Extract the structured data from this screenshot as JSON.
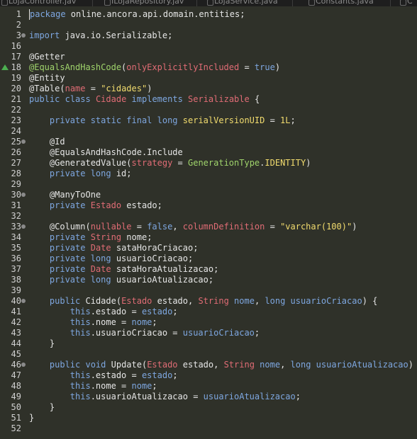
{
  "tabs": [
    {
      "label": "LojaController.jav"
    },
    {
      "label": "ILojaRepository.jav"
    },
    {
      "label": "LojaService.java"
    },
    {
      "label": "Constants.java"
    },
    {
      "label": "C"
    }
  ],
  "lines": [
    {
      "n": "1",
      "code": [
        {
          "c": "kw",
          "t": "package"
        },
        {
          "c": "fld",
          "t": " online.ancora.api.domain.entities;"
        }
      ]
    },
    {
      "n": "2",
      "code": []
    },
    {
      "n": "3",
      "fold": true,
      "code": [
        {
          "c": "kw",
          "t": "import"
        },
        {
          "c": "fld",
          "t": " java.io.Serializable;"
        }
      ]
    },
    {
      "n": "16",
      "code": []
    },
    {
      "n": "17",
      "code": [
        {
          "c": "an",
          "t": "@Getter"
        }
      ]
    },
    {
      "n": "18",
      "marker": true,
      "code": [
        {
          "c": "an2",
          "t": "@EqualsAndHashCode"
        },
        {
          "c": "fld",
          "t": "("
        },
        {
          "c": "pr",
          "t": "onlyExplicitlyIncluded"
        },
        {
          "c": "fld",
          "t": " = "
        },
        {
          "c": "kw",
          "t": "true"
        },
        {
          "c": "fld",
          "t": ")"
        }
      ]
    },
    {
      "n": "19",
      "code": [
        {
          "c": "an",
          "t": "@Entity"
        }
      ]
    },
    {
      "n": "20",
      "code": [
        {
          "c": "an",
          "t": "@Table"
        },
        {
          "c": "fld",
          "t": "("
        },
        {
          "c": "pr",
          "t": "name"
        },
        {
          "c": "fld",
          "t": " = "
        },
        {
          "c": "st",
          "t": "\"cidades\""
        },
        {
          "c": "fld",
          "t": ")"
        }
      ]
    },
    {
      "n": "21",
      "code": [
        {
          "c": "kw",
          "t": "public"
        },
        {
          "c": "fld",
          "t": " "
        },
        {
          "c": "kw",
          "t": "class"
        },
        {
          "c": "fld",
          "t": " "
        },
        {
          "c": "ty",
          "t": "Cidade"
        },
        {
          "c": "fld",
          "t": " "
        },
        {
          "c": "kw",
          "t": "implements"
        },
        {
          "c": "fld",
          "t": " "
        },
        {
          "c": "ty",
          "t": "Serializable"
        },
        {
          "c": "fld",
          "t": " {"
        }
      ]
    },
    {
      "n": "22",
      "code": []
    },
    {
      "n": "23",
      "code": [
        {
          "c": "fld",
          "t": "    "
        },
        {
          "c": "kw",
          "t": "private static final long"
        },
        {
          "c": "fld",
          "t": " "
        },
        {
          "c": "st",
          "t": "serialVersionUID"
        },
        {
          "c": "fld",
          "t": " = "
        },
        {
          "c": "nu",
          "t": "1L"
        },
        {
          "c": "fld",
          "t": ";"
        }
      ]
    },
    {
      "n": "24",
      "code": []
    },
    {
      "n": "25",
      "fold": true,
      "code": [
        {
          "c": "fld",
          "t": "    "
        },
        {
          "c": "an",
          "t": "@Id"
        }
      ]
    },
    {
      "n": "26",
      "code": [
        {
          "c": "fld",
          "t": "    "
        },
        {
          "c": "an",
          "t": "@EqualsAndHashCode.Include"
        }
      ]
    },
    {
      "n": "27",
      "code": [
        {
          "c": "fld",
          "t": "    "
        },
        {
          "c": "an",
          "t": "@GeneratedValue"
        },
        {
          "c": "fld",
          "t": "("
        },
        {
          "c": "pr",
          "t": "strategy"
        },
        {
          "c": "fld",
          "t": " = "
        },
        {
          "c": "an2",
          "t": "GenerationType"
        },
        {
          "c": "fld",
          "t": "."
        },
        {
          "c": "st",
          "t": "IDENTITY"
        },
        {
          "c": "fld",
          "t": ")"
        }
      ]
    },
    {
      "n": "28",
      "code": [
        {
          "c": "fld",
          "t": "    "
        },
        {
          "c": "kw",
          "t": "private long"
        },
        {
          "c": "fld",
          "t": " id;"
        }
      ]
    },
    {
      "n": "29",
      "code": []
    },
    {
      "n": "30",
      "fold": true,
      "code": [
        {
          "c": "fld",
          "t": "    "
        },
        {
          "c": "an",
          "t": "@ManyToOne"
        }
      ]
    },
    {
      "n": "31",
      "code": [
        {
          "c": "fld",
          "t": "    "
        },
        {
          "c": "kw",
          "t": "private"
        },
        {
          "c": "fld",
          "t": " "
        },
        {
          "c": "ty",
          "t": "Estado"
        },
        {
          "c": "fld",
          "t": " estado;"
        }
      ]
    },
    {
      "n": "32",
      "code": []
    },
    {
      "n": "33",
      "fold": true,
      "code": [
        {
          "c": "fld",
          "t": "    "
        },
        {
          "c": "an",
          "t": "@Column"
        },
        {
          "c": "fld",
          "t": "("
        },
        {
          "c": "pr",
          "t": "nullable"
        },
        {
          "c": "fld",
          "t": " = "
        },
        {
          "c": "kw",
          "t": "false"
        },
        {
          "c": "fld",
          "t": ", "
        },
        {
          "c": "pr",
          "t": "columnDefinition"
        },
        {
          "c": "fld",
          "t": " = "
        },
        {
          "c": "st",
          "t": "\"varchar(100)\""
        },
        {
          "c": "fld",
          "t": ")"
        }
      ]
    },
    {
      "n": "34",
      "code": [
        {
          "c": "fld",
          "t": "    "
        },
        {
          "c": "kw",
          "t": "private"
        },
        {
          "c": "fld",
          "t": " "
        },
        {
          "c": "ty",
          "t": "String"
        },
        {
          "c": "fld",
          "t": " nome;"
        }
      ]
    },
    {
      "n": "35",
      "code": [
        {
          "c": "fld",
          "t": "    "
        },
        {
          "c": "kw",
          "t": "private"
        },
        {
          "c": "fld",
          "t": " "
        },
        {
          "c": "ty",
          "t": "Date"
        },
        {
          "c": "fld",
          "t": " sataHoraCriacao;"
        }
      ]
    },
    {
      "n": "36",
      "code": [
        {
          "c": "fld",
          "t": "    "
        },
        {
          "c": "kw",
          "t": "private long"
        },
        {
          "c": "fld",
          "t": " usuarioCriacao;"
        }
      ]
    },
    {
      "n": "37",
      "code": [
        {
          "c": "fld",
          "t": "    "
        },
        {
          "c": "kw",
          "t": "private"
        },
        {
          "c": "fld",
          "t": " "
        },
        {
          "c": "ty",
          "t": "Date"
        },
        {
          "c": "fld",
          "t": " sataHoraAtualizacao;"
        }
      ]
    },
    {
      "n": "38",
      "code": [
        {
          "c": "fld",
          "t": "    "
        },
        {
          "c": "kw",
          "t": "private long"
        },
        {
          "c": "fld",
          "t": " usuarioAtualizacao;"
        }
      ]
    },
    {
      "n": "39",
      "code": []
    },
    {
      "n": "40",
      "fold": true,
      "code": [
        {
          "c": "fld",
          "t": "    "
        },
        {
          "c": "kw",
          "t": "public"
        },
        {
          "c": "fld",
          "t": " Cidade("
        },
        {
          "c": "ty",
          "t": "Estado"
        },
        {
          "c": "fld",
          "t": " estado, "
        },
        {
          "c": "ty",
          "t": "String"
        },
        {
          "c": "fld",
          "t": " "
        },
        {
          "c": "vr",
          "t": "nome"
        },
        {
          "c": "fld",
          "t": ", "
        },
        {
          "c": "kw",
          "t": "long"
        },
        {
          "c": "fld",
          "t": " "
        },
        {
          "c": "vr",
          "t": "usuarioCriacao"
        },
        {
          "c": "fld",
          "t": ") {"
        }
      ]
    },
    {
      "n": "41",
      "code": [
        {
          "c": "fld",
          "t": "        "
        },
        {
          "c": "kw",
          "t": "this"
        },
        {
          "c": "fld",
          "t": ".estado = "
        },
        {
          "c": "vr",
          "t": "estado"
        },
        {
          "c": "fld",
          "t": ";"
        }
      ]
    },
    {
      "n": "42",
      "code": [
        {
          "c": "fld",
          "t": "        "
        },
        {
          "c": "kw",
          "t": "this"
        },
        {
          "c": "fld",
          "t": ".nome = "
        },
        {
          "c": "vr",
          "t": "nome"
        },
        {
          "c": "fld",
          "t": ";"
        }
      ]
    },
    {
      "n": "43",
      "code": [
        {
          "c": "fld",
          "t": "        "
        },
        {
          "c": "kw",
          "t": "this"
        },
        {
          "c": "fld",
          "t": ".usuarioCriacao = "
        },
        {
          "c": "vr",
          "t": "usuarioCriacao"
        },
        {
          "c": "fld",
          "t": ";"
        }
      ]
    },
    {
      "n": "44",
      "code": [
        {
          "c": "fld",
          "t": "    }"
        }
      ]
    },
    {
      "n": "45",
      "code": []
    },
    {
      "n": "46",
      "fold": true,
      "code": [
        {
          "c": "fld",
          "t": "    "
        },
        {
          "c": "kw",
          "t": "public void"
        },
        {
          "c": "fld",
          "t": " Update("
        },
        {
          "c": "ty",
          "t": "Estado"
        },
        {
          "c": "fld",
          "t": " estado, "
        },
        {
          "c": "ty",
          "t": "String"
        },
        {
          "c": "fld",
          "t": " "
        },
        {
          "c": "vr",
          "t": "nome"
        },
        {
          "c": "fld",
          "t": ", "
        },
        {
          "c": "kw",
          "t": "long"
        },
        {
          "c": "fld",
          "t": " "
        },
        {
          "c": "vr",
          "t": "usuarioAtualizacao"
        },
        {
          "c": "fld",
          "t": ") {"
        }
      ]
    },
    {
      "n": "47",
      "code": [
        {
          "c": "fld",
          "t": "        "
        },
        {
          "c": "kw",
          "t": "this"
        },
        {
          "c": "fld",
          "t": ".estado = "
        },
        {
          "c": "vr",
          "t": "estado"
        },
        {
          "c": "fld",
          "t": ";"
        }
      ]
    },
    {
      "n": "48",
      "code": [
        {
          "c": "fld",
          "t": "        "
        },
        {
          "c": "kw",
          "t": "this"
        },
        {
          "c": "fld",
          "t": ".nome = "
        },
        {
          "c": "vr",
          "t": "nome"
        },
        {
          "c": "fld",
          "t": ";"
        }
      ]
    },
    {
      "n": "49",
      "code": [
        {
          "c": "fld",
          "t": "        "
        },
        {
          "c": "kw",
          "t": "this"
        },
        {
          "c": "fld",
          "t": ".usuarioAtualizacao = "
        },
        {
          "c": "vr",
          "t": "usuarioAtualizacao"
        },
        {
          "c": "fld",
          "t": ";"
        }
      ]
    },
    {
      "n": "50",
      "code": [
        {
          "c": "fld",
          "t": "    }"
        }
      ]
    },
    {
      "n": "51",
      "code": [
        {
          "c": "fld",
          "t": "}"
        }
      ]
    },
    {
      "n": "52",
      "code": []
    }
  ]
}
